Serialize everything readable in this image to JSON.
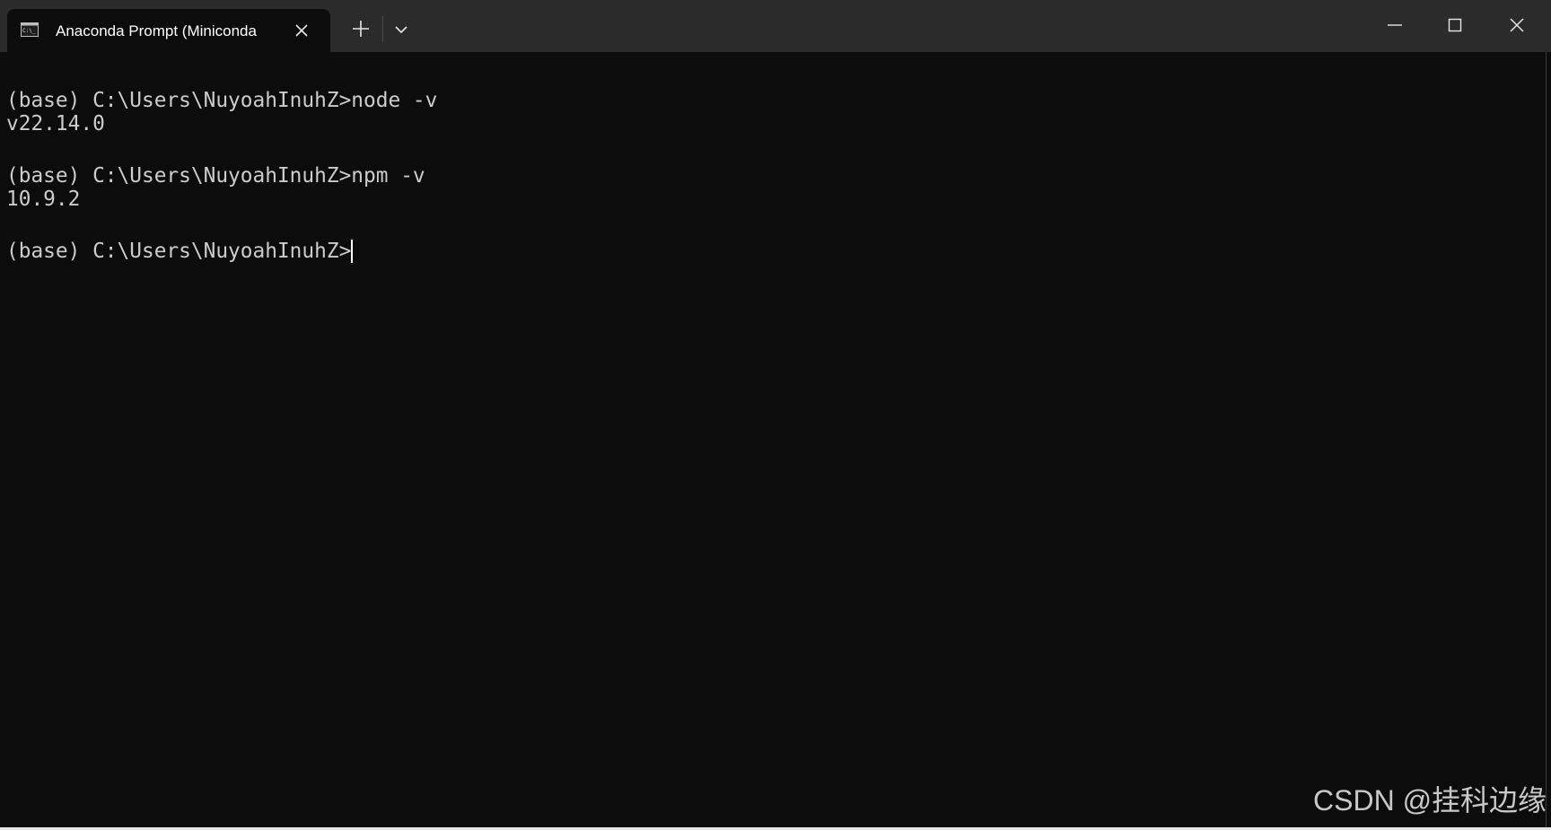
{
  "window": {
    "tab_title": "Anaconda Prompt (Miniconda",
    "tab_icon": "terminal-icon",
    "titlebar_color": "#2b2b2b",
    "background_color": "#0c0c0c",
    "text_color": "#cccccc"
  },
  "terminal": {
    "lines": [
      "(base) C:\\Users\\NuyoahInuhZ>node -v",
      "v22.14.0",
      "",
      "(base) C:\\Users\\NuyoahInuhZ>npm -v",
      "10.9.2",
      "",
      "(base) C:\\Users\\NuyoahInuhZ>"
    ]
  },
  "watermark": {
    "text": "CSDN @挂科边缘"
  }
}
